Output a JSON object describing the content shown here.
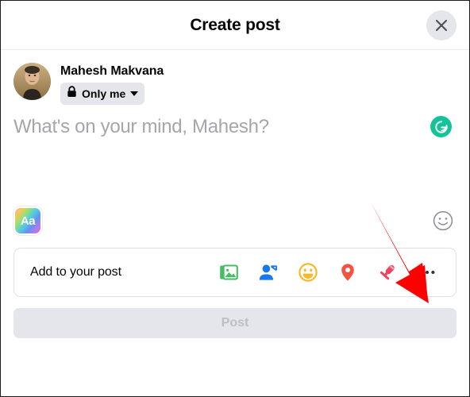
{
  "window": {
    "title": "Create post",
    "close_icon": "close-icon"
  },
  "composer": {
    "user_name": "Mahesh Makvana",
    "avatar_icon": "avatar-photo",
    "privacy": {
      "label": "Only me",
      "lock_icon": "lock-icon",
      "chevron_icon": "chevron-down-icon"
    },
    "placeholder": "What's on your mind, Mahesh?",
    "text_value": "",
    "grammarly_icon": "grammarly-icon",
    "background_picker": {
      "label": "Aa",
      "icon": "text-background-icon"
    },
    "emoji_picker_icon": "smiley-face-icon"
  },
  "add_to_post": {
    "label": "Add to your post",
    "items": [
      {
        "name": "photo-video-icon",
        "label": "Photo/video",
        "color": "#45bd62"
      },
      {
        "name": "tag-people-icon",
        "label": "Tag people",
        "color": "#1877f2"
      },
      {
        "name": "feeling-activity-icon",
        "label": "Feeling/activity",
        "color": "#f7b928"
      },
      {
        "name": "check-in-location-icon",
        "label": "Check in",
        "color": "#f5533d"
      },
      {
        "name": "live-video-icon",
        "label": "Live video",
        "color": "#f3425f"
      },
      {
        "name": "more-options-icon",
        "label": "More options",
        "color": "#333333"
      }
    ]
  },
  "footer": {
    "post_label": "Post",
    "post_enabled": false
  },
  "annotation": {
    "arrow_color": "#ff0000",
    "points_to": "more-options-icon"
  },
  "colors": {
    "accent": "#1877f2",
    "pill_bg": "#e4e6eb",
    "placeholder": "#a3a6ab",
    "grammarly_green": "#15c39a"
  }
}
